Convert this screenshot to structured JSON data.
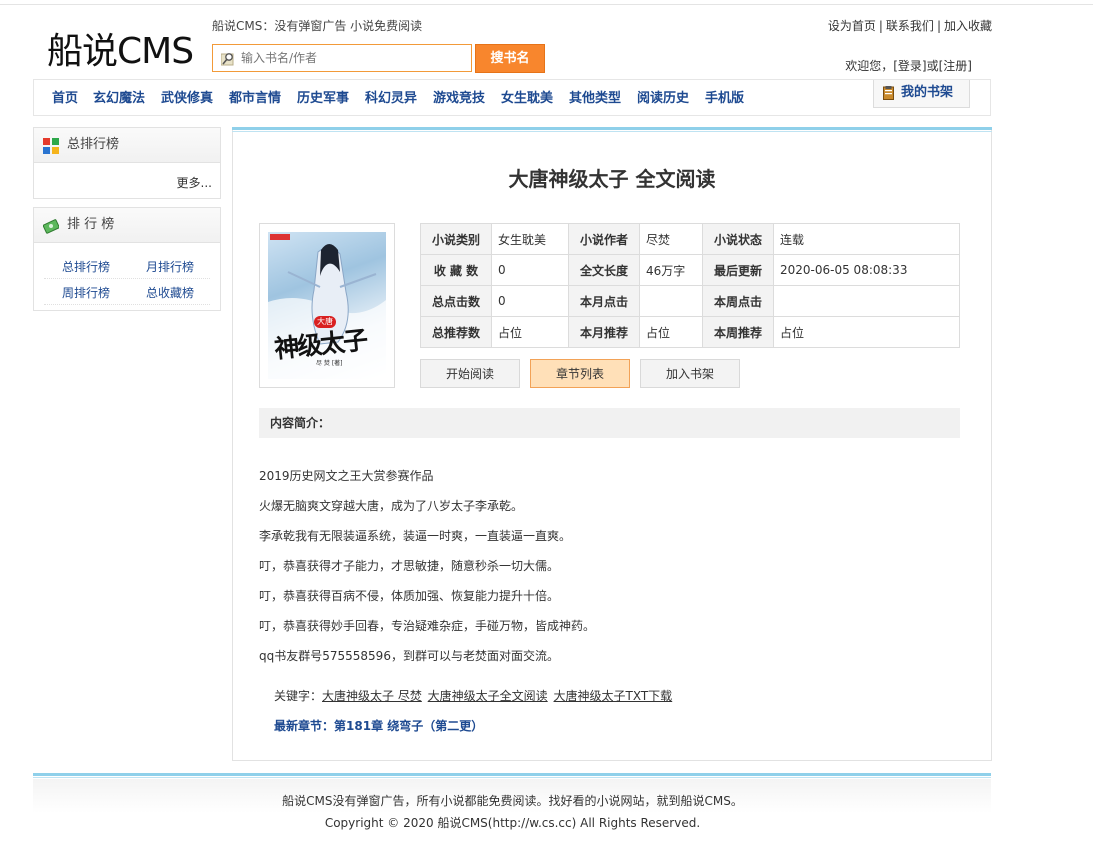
{
  "site": {
    "logo": "船说CMS",
    "slogan": "船说CMS：没有弹窗广告 小说免费阅读",
    "top_links": [
      "设为首页",
      "联系我们",
      "加入收藏"
    ],
    "welcome_prefix": "欢迎您，",
    "login": "[登录]",
    "or": "或",
    "register": "[注册]"
  },
  "search": {
    "placeholder": "输入书名/作者",
    "button": "搜书名"
  },
  "nav": [
    "首页",
    "玄幻魔法",
    "武侠修真",
    "都市言情",
    "历史军事",
    "科幻灵异",
    "游戏竞技",
    "女生耽美",
    "其他类型",
    "阅读历史",
    "手机版"
  ],
  "shelf": "我的书架",
  "sidebar": {
    "box1_title": "总排行榜",
    "box1_more": "更多...",
    "box2_title": "排 行 榜",
    "links": [
      "总排行榜",
      "月排行榜",
      "周排行榜",
      "总收藏榜"
    ]
  },
  "book": {
    "title": "大唐神级太子 全文阅读",
    "cover_text": "神级太子",
    "cover_badge": "大唐",
    "cover_author": "尽 焚 [著]",
    "info": [
      [
        "小说类别",
        "女生耽美",
        "小说作者",
        "尽焚",
        "小说状态",
        "连载"
      ],
      [
        "收 藏 数",
        "0",
        "全文长度",
        "46万字",
        "最后更新",
        "2020-06-05 08:08:33"
      ],
      [
        "总点击数",
        "0",
        "本月点击",
        "",
        "本周点击",
        ""
      ],
      [
        "总推荐数",
        "占位",
        "本月推荐",
        "占位",
        "本周推荐",
        "占位"
      ]
    ],
    "buttons": [
      "开始阅读",
      "章节列表",
      "加入书架"
    ],
    "intro_label": "内容简介：",
    "intro": [
      "2019历史网文之王大赏参赛作品",
      "火爆无脑爽文穿越大唐，成为了八岁太子李承乾。",
      "李承乾我有无限装逼系统，装逼一时爽，一直装逼一直爽。",
      "叮，恭喜获得才子能力，才思敏捷，随意秒杀一切大儒。",
      "叮，恭喜获得百病不侵，体质加强、恢复能力提升十倍。",
      "叮，恭喜获得妙手回春，专治疑难杂症，手碰万物，皆成神药。",
      "qq书友群号575558596，到群可以与老焚面对面交流。"
    ],
    "keywords_label": "关键字：",
    "keywords": [
      "大唐神级太子 尽焚",
      "大唐神级太子全文阅读",
      "大唐神级太子TXT下载"
    ],
    "latest_label": "最新章节：",
    "latest_chapter": "第181章 绕弯子（第二更）"
  },
  "footer": {
    "line1": "船说CMS没有弹窗广告，所有小说都能免费阅读。找好看的小说网站，就到船说CMS。",
    "line2": "Copyright © 2020 船说CMS(http://w.cs.cc) All Rights Reserved."
  }
}
